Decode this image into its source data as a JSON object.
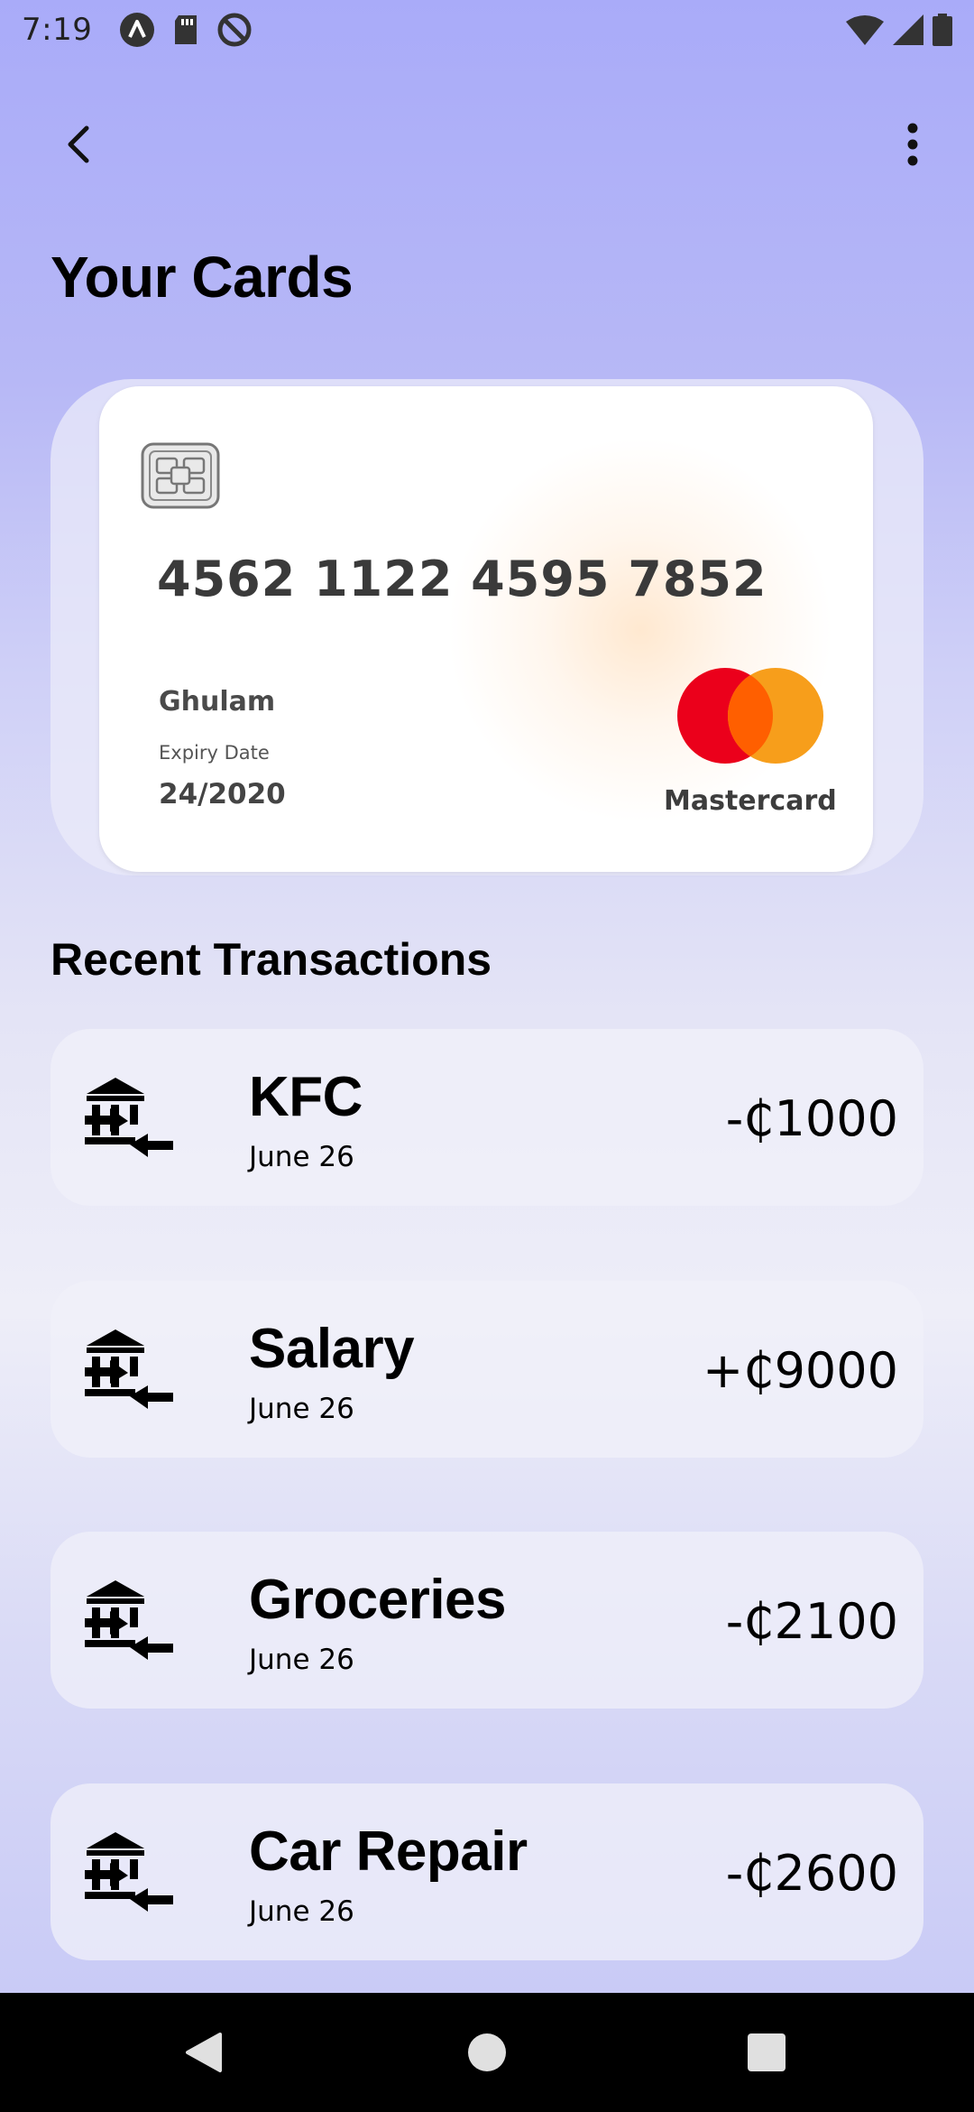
{
  "status_bar": {
    "time": "7:19",
    "icons_left": [
      "a-badge-icon",
      "sd-card-icon",
      "at-sign-icon"
    ],
    "icons_right": [
      "wifi-icon",
      "signal-icon",
      "battery-icon"
    ]
  },
  "top_bar": {
    "back_icon": "chevron-left-icon",
    "more_icon": "more-vert-icon"
  },
  "page_title": "Your Cards",
  "card": {
    "number": "4562 1122 4595 7852",
    "holder": "Ghulam",
    "expiry_label": "Expiry Date",
    "expiry_value": "24/2020",
    "brand": "Mastercard",
    "brand_colors": {
      "red": "#eb001b",
      "orange": "#f79e1b",
      "overlap": "#ff5f00"
    }
  },
  "section_title": "Recent Transactions",
  "transactions": [
    {
      "name": "KFC",
      "date": "June 26",
      "amount": "-₵1000",
      "icon": "bank-transfer-icon"
    },
    {
      "name": "Salary",
      "date": "June 26",
      "amount": "+₵9000",
      "icon": "bank-transfer-icon"
    },
    {
      "name": "Groceries",
      "date": "June 26",
      "amount": "-₵2100",
      "icon": "bank-transfer-icon"
    },
    {
      "name": "Car Repair",
      "date": "June 26",
      "amount": "-₵2600",
      "icon": "bank-transfer-icon"
    }
  ],
  "nav_bar": {
    "back_icon": "nav-back-triangle-icon",
    "home_icon": "nav-home-circle-icon",
    "recents_icon": "nav-recents-square-icon"
  }
}
